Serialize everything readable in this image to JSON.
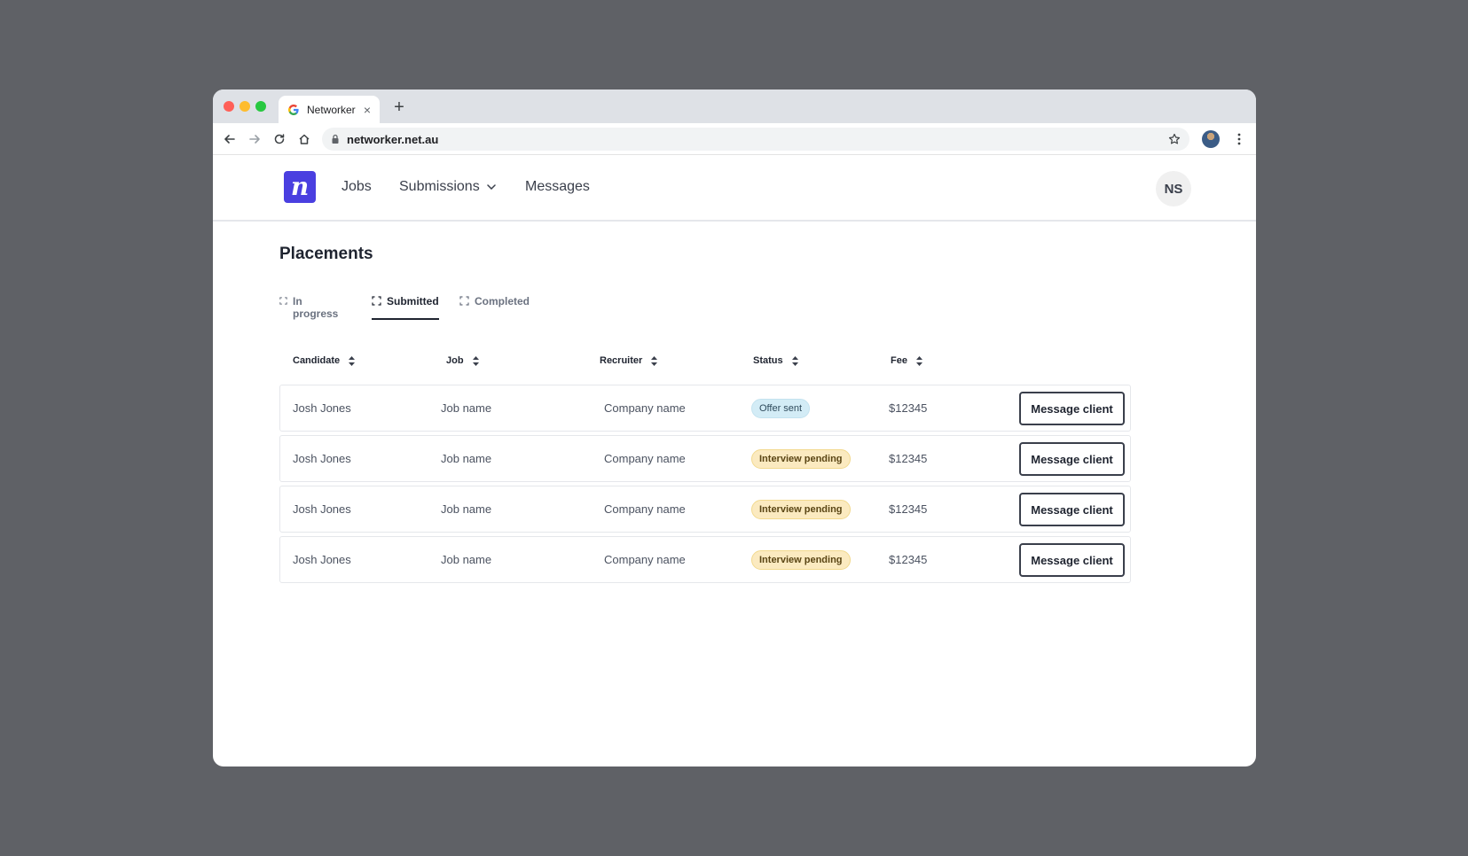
{
  "browser": {
    "tab_title": "Networker",
    "tab_close": "×",
    "new_tab": "+",
    "url": "networker.net.au"
  },
  "header": {
    "logo_letter": "n",
    "nav": [
      {
        "label": "Jobs"
      },
      {
        "label": "Submissions"
      },
      {
        "label": "Messages"
      }
    ],
    "avatar_initials": "NS",
    "brand_color": "#4a3fe0"
  },
  "page": {
    "title": "Placements",
    "tabs": [
      {
        "label": "In progress",
        "active": false
      },
      {
        "label": "Submitted",
        "active": true
      },
      {
        "label": "Completed",
        "active": false
      }
    ]
  },
  "table": {
    "columns": [
      "Candidate",
      "Job",
      "Recruiter",
      "Status",
      "Fee"
    ],
    "rows": [
      {
        "candidate": "Josh Jones",
        "job": "Job name",
        "recruiter": "Company name",
        "status": "Offer sent",
        "fee": "$12345",
        "action": "Message client"
      },
      {
        "candidate": "Josh Jones",
        "job": "Job name",
        "recruiter": "Company name",
        "status": "Interview pending",
        "fee": "$12345",
        "action": "Message client"
      },
      {
        "candidate": "Josh Jones",
        "job": "Job name",
        "recruiter": "Company name",
        "status": "Interview pending",
        "fee": "$12345",
        "action": "Message client"
      },
      {
        "candidate": "Josh Jones",
        "job": "Job name",
        "recruiter": "Company name",
        "status": "Interview pending",
        "fee": "$12345",
        "action": "Message client"
      }
    ]
  },
  "status_colors": {
    "offer_sent": "#d3ecf6",
    "interview_pending": "#fbeac0"
  }
}
